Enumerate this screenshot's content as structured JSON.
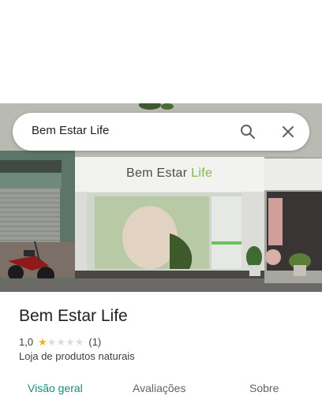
{
  "search": {
    "query": "Bem Estar Life"
  },
  "storefront_sign": {
    "part1": "Bem Estar ",
    "part2": "Life"
  },
  "place": {
    "name": "Bem Estar Life",
    "rating": "1,0",
    "rating_value": 1,
    "rating_max": 5,
    "review_count": "(1)",
    "category": "Loja de produtos naturais"
  },
  "tabs": [
    {
      "label": "Visão geral",
      "active": true
    },
    {
      "label": "Avaliações",
      "active": false
    },
    {
      "label": "Sobre",
      "active": false
    }
  ],
  "colors": {
    "accent": "#188b7c",
    "star_filled": "#f6b400",
    "star_empty": "#dadce0"
  },
  "icons": {
    "search": "search-icon",
    "close": "close-icon"
  }
}
